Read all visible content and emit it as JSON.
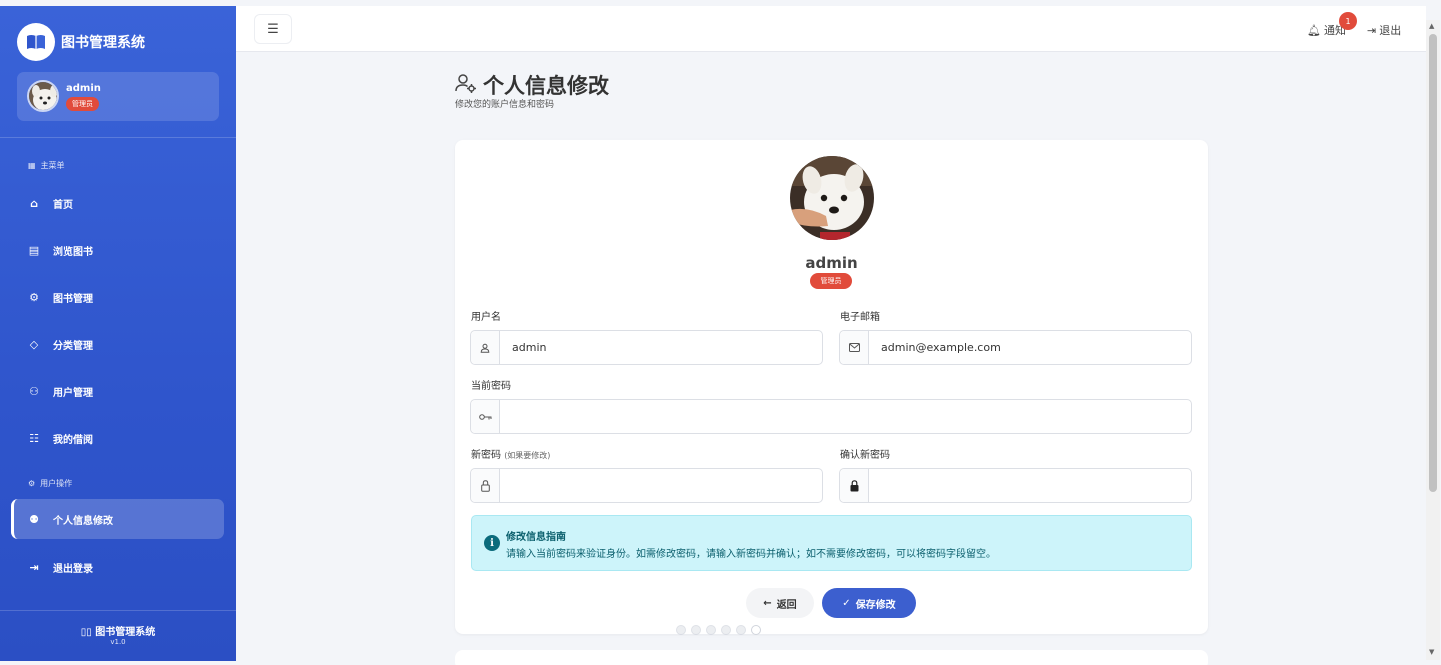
{
  "sidebar": {
    "brand_title": "图书管理系统",
    "user_name": "admin",
    "user_role": "管理员",
    "section_main": "主菜单",
    "section_user": "用户操作",
    "menu_main": [
      {
        "label": "首页",
        "icon": "home-icon"
      },
      {
        "label": "浏览图书",
        "icon": "book-list-icon"
      },
      {
        "label": "图书管理",
        "icon": "gear-icon"
      },
      {
        "label": "分类管理",
        "icon": "tag-icon"
      },
      {
        "label": "用户管理",
        "icon": "users-icon"
      },
      {
        "label": "我的借阅",
        "icon": "borrow-list-icon"
      }
    ],
    "menu_user": [
      {
        "label": "个人信息修改",
        "icon": "user-gear-icon",
        "active": true
      },
      {
        "label": "退出登录",
        "icon": "logout-icon"
      }
    ],
    "footer_title": "图书管理系统",
    "footer_version": "v1.0"
  },
  "topbar": {
    "notify_label": "通知",
    "notify_count": "1",
    "logout_label": "退出"
  },
  "page": {
    "title": "个人信息修改",
    "subtitle": "修改您的账户信息和密码"
  },
  "profile": {
    "name": "admin",
    "role": "管理员"
  },
  "form": {
    "username_label": "用户名",
    "username_value": "admin",
    "email_label": "电子邮箱",
    "email_value": "admin@example.com",
    "current_password_label": "当前密码",
    "new_password_label": "新密码",
    "new_password_hint": "(如果要修改)",
    "confirm_password_label": "确认新密码"
  },
  "info": {
    "title": "修改信息指南",
    "text": "请输入当前密码来验证身份。如需修改密码，请输入新密码并确认；如不需要修改密码，可以将密码字段留空。"
  },
  "buttons": {
    "back_label": "返回",
    "save_label": "保存修改"
  },
  "colors": {
    "sidebar": "#3a63d8",
    "accent": "#3c5fcf",
    "badge": "#e14b3b",
    "info_bg": "#cdf4fa"
  }
}
